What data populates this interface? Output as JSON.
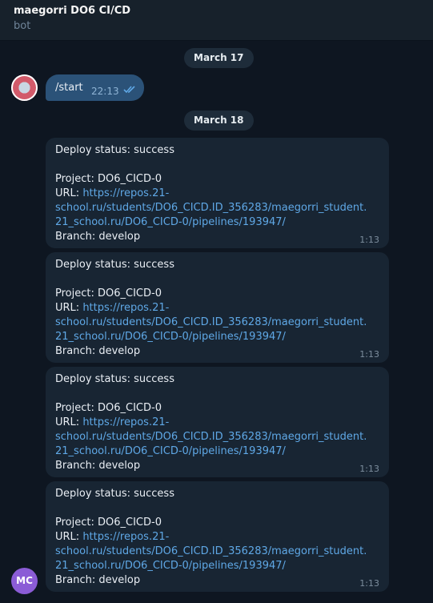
{
  "header": {
    "title": "maegorri DO6 CI/CD",
    "subtitle": "bot"
  },
  "dates": [
    "March 17",
    "March 18"
  ],
  "outgoing": {
    "text": "/start",
    "time": "22:13"
  },
  "messages": [
    {
      "status": "Deploy status: success",
      "project": "Project: DO6_CICD-0",
      "url_label": "URL: ",
      "url_line1": "https://repos.21-",
      "url_line2": "school.ru/students/DO6_CICD.ID_356283/maegorri_student.",
      "url_line3": "21_school.ru/DO6_CICD-0/pipelines/193947/",
      "branch": "Branch: develop",
      "time": "1:13"
    },
    {
      "status": "Deploy status: success",
      "project": "Project: DO6_CICD-0",
      "url_label": "URL: ",
      "url_line1": "https://repos.21-",
      "url_line2": "school.ru/students/DO6_CICD.ID_356283/maegorri_student.",
      "url_line3": "21_school.ru/DO6_CICD-0/pipelines/193947/",
      "branch": "Branch: develop",
      "time": "1:13"
    },
    {
      "status": "Deploy status: success",
      "project": "Project: DO6_CICD-0",
      "url_label": "URL: ",
      "url_line1": "https://repos.21-",
      "url_line2": "school.ru/students/DO6_CICD.ID_356283/maegorri_student.",
      "url_line3": "21_school.ru/DO6_CICD-0/pipelines/193947/",
      "branch": "Branch: develop",
      "time": "1:13"
    },
    {
      "status": "Deploy status: success",
      "project": "Project: DO6_CICD-0",
      "url_label": "URL: ",
      "url_line1": "https://repos.21-",
      "url_line2": "school.ru/students/DO6_CICD.ID_356283/maegorri_student.",
      "url_line3": "21_school.ru/DO6_CICD-0/pipelines/193947/",
      "branch": "Branch: develop",
      "time": "1:13"
    }
  ],
  "user_avatar": {
    "initials": "MC",
    "color": "#8b5cd6"
  },
  "colors": {
    "background": "#0e1621",
    "header": "#17212b",
    "incoming": "#182533",
    "outgoing": "#2b5278",
    "link": "#5fa8e6"
  },
  "icons": {
    "read_receipt": "double-check-icon"
  }
}
